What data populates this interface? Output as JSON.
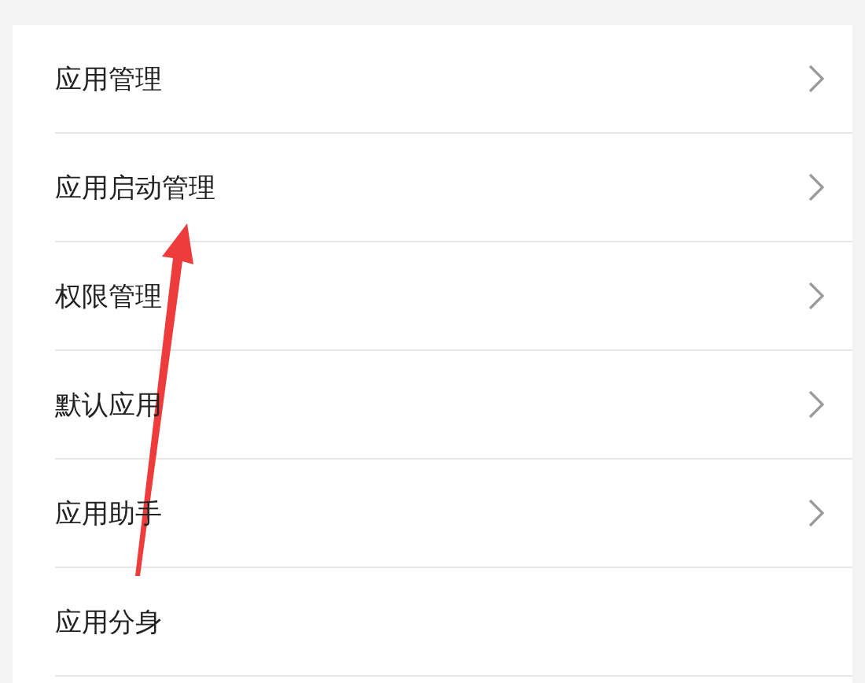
{
  "settings_list": [
    {
      "label": "应用管理",
      "chevron": true
    },
    {
      "label": "应用启动管理",
      "chevron": true
    },
    {
      "label": "权限管理",
      "chevron": true
    },
    {
      "label": "默认应用",
      "chevron": true
    },
    {
      "label": "应用助手",
      "chevron": true
    },
    {
      "label": "应用分身",
      "chevron": false
    }
  ]
}
